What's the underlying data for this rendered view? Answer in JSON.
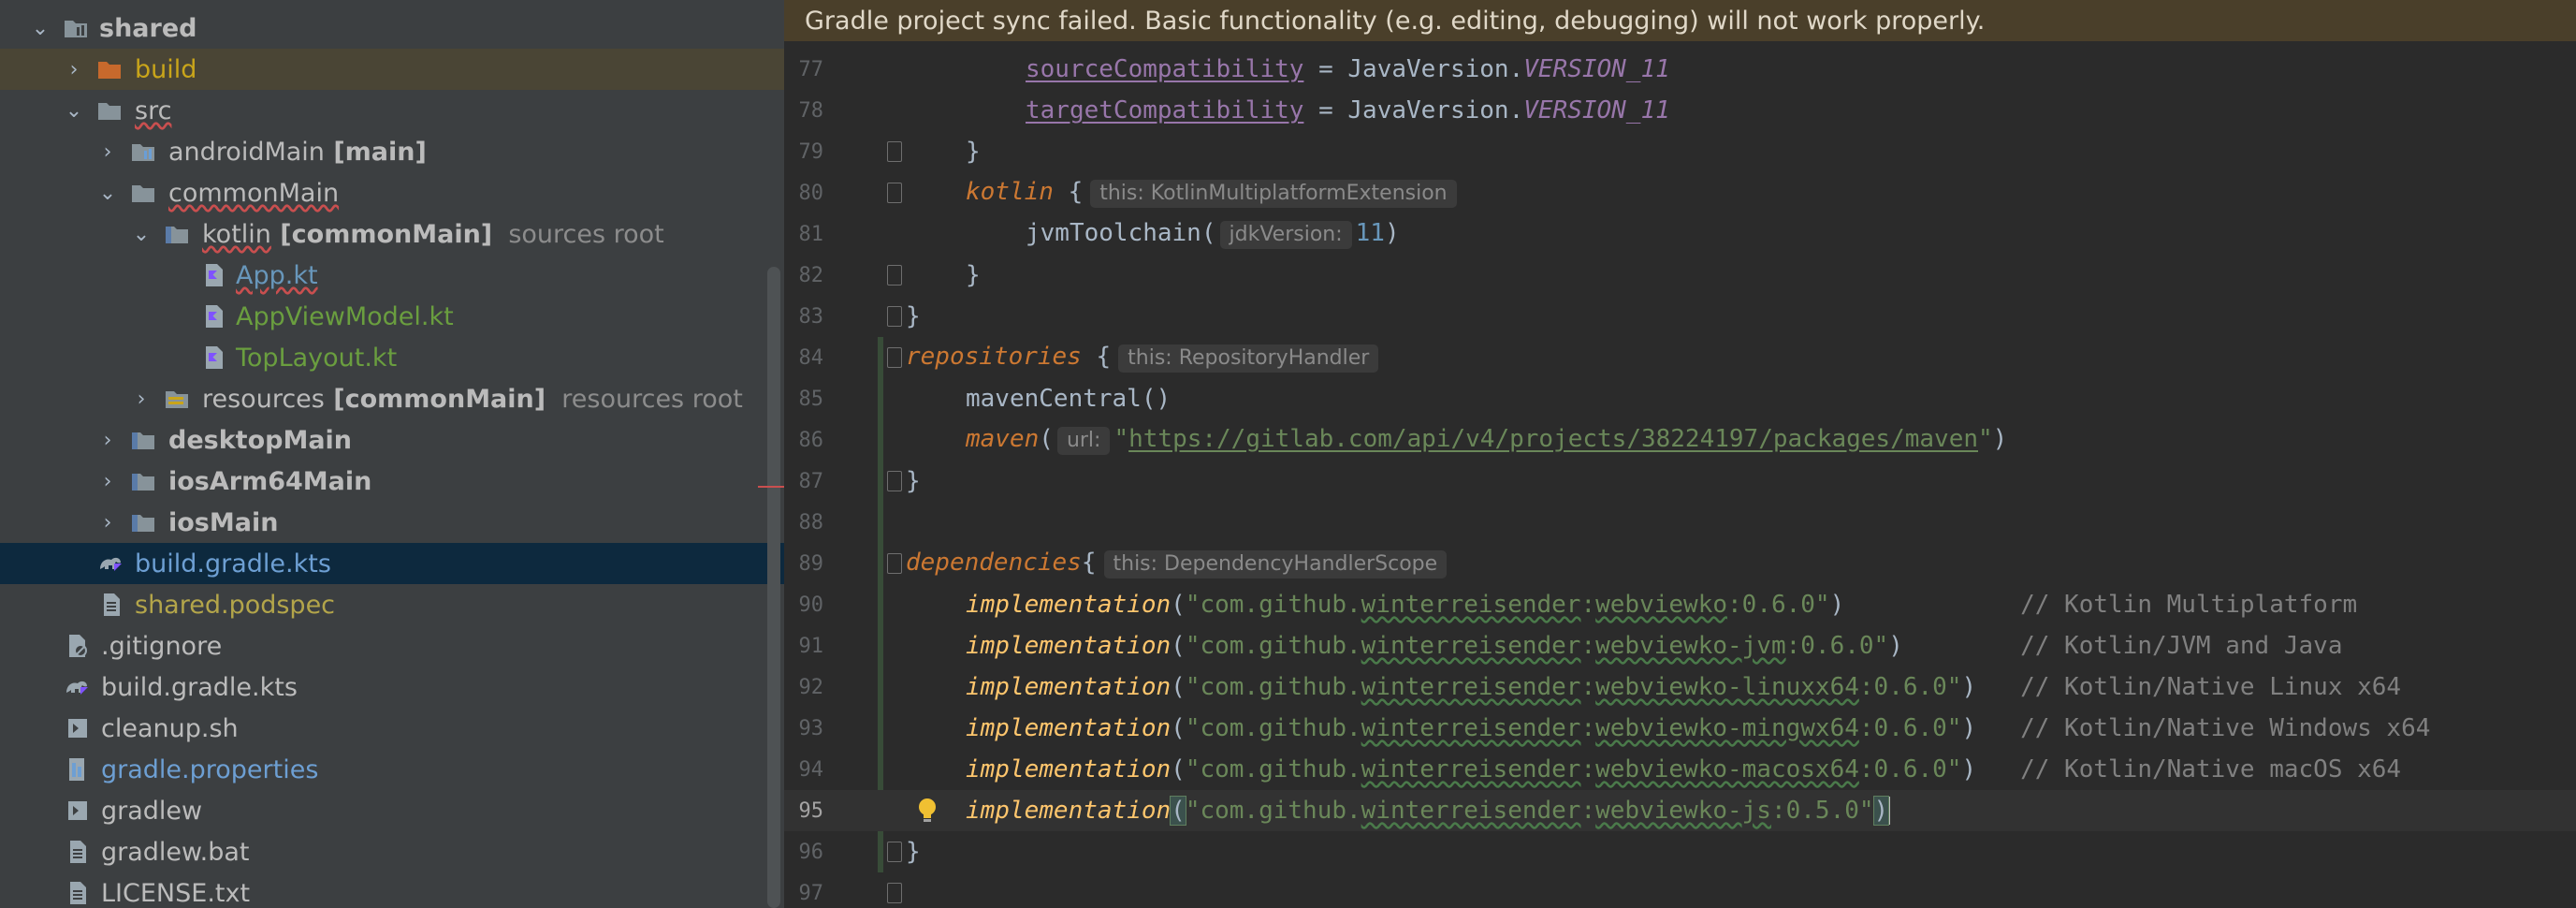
{
  "banner": "Gradle project sync failed. Basic functionality (e.g. editing, debugging) will not work properly.",
  "tree": {
    "top_partial": "…_ _ _ …",
    "items": [
      {
        "label": "shared",
        "suffix": "",
        "note": ""
      },
      {
        "label": "build",
        "suffix": "",
        "note": ""
      },
      {
        "label": "src",
        "suffix": "",
        "note": ""
      },
      {
        "label": "androidMain",
        "suffix": " [main]",
        "note": ""
      },
      {
        "label": "commonMain",
        "suffix": "",
        "note": ""
      },
      {
        "label": "kotlin",
        "suffix": " [commonMain]",
        "note": "sources root"
      },
      {
        "label": "App.kt",
        "suffix": "",
        "note": ""
      },
      {
        "label": "AppViewModel.kt",
        "suffix": "",
        "note": ""
      },
      {
        "label": "TopLayout.kt",
        "suffix": "",
        "note": ""
      },
      {
        "label": "resources",
        "suffix": " [commonMain]",
        "note": "resources root"
      },
      {
        "label": "desktopMain",
        "suffix": "",
        "note": ""
      },
      {
        "label": "iosArm64Main",
        "suffix": "",
        "note": ""
      },
      {
        "label": "iosMain",
        "suffix": "",
        "note": ""
      },
      {
        "label": "build.gradle.kts",
        "suffix": "",
        "note": ""
      },
      {
        "label": "shared.podspec",
        "suffix": "",
        "note": ""
      },
      {
        "label": ".gitignore",
        "suffix": "",
        "note": ""
      },
      {
        "label": "build.gradle.kts",
        "suffix": "",
        "note": ""
      },
      {
        "label": "cleanup.sh",
        "suffix": "",
        "note": ""
      },
      {
        "label": "gradle.properties",
        "suffix": "",
        "note": ""
      },
      {
        "label": "gradlew",
        "suffix": "",
        "note": ""
      },
      {
        "label": "gradlew.bat",
        "suffix": "",
        "note": ""
      },
      {
        "label": "LICENSE.txt",
        "suffix": "",
        "note": ""
      }
    ]
  },
  "editor": {
    "line_numbers": [
      "77",
      "78",
      "79",
      "80",
      "81",
      "82",
      "83",
      "84",
      "85",
      "86",
      "87",
      "88",
      "89",
      "90",
      "91",
      "92",
      "93",
      "94",
      "95",
      "96",
      "97"
    ],
    "code": {
      "l77_a": "sourceCompatibility",
      "l77_b": " = JavaVersion.",
      "l77_c": "VERSION_11",
      "l78_a": "targetCompatibility",
      "l78_b": " = JavaVersion.",
      "l78_c": "VERSION_11",
      "l79": "}",
      "l80_a": "kotlin",
      "l80_b": " {",
      "l80_hint": "this: KotlinMultiplatformExtension",
      "l81_a": "jvmToolchain(",
      "l81_hint": "jdkVersion:",
      "l81_num": "11",
      "l81_b": ")",
      "l82": "}",
      "l83": "}",
      "l84_a": "repositories",
      "l84_b": " {",
      "l84_hint": "this: RepositoryHandler",
      "l85": "mavenCentral()",
      "l86_a": "maven",
      "l86_b": "(",
      "l86_hint": "url:",
      "l86_q1": "\"",
      "l86_url": "https://gitlab.com/api/v4/projects/38224197/packages/maven",
      "l86_q2": "\"",
      "l86_c": ")",
      "l87": "}",
      "l89_a": "dependencies",
      "l89_b": "{",
      "l89_hint": "this: DependencyHandlerScope",
      "dep_fn": "implementation",
      "dep_prefix": "\"com.github.",
      "dep_group": "winterreisender",
      "dep_colon": ":",
      "l90_art": "webviewko",
      "l90_ver": ":0.6.0\"",
      "l90_pad": ")            ",
      "l90_cmt": "// Kotlin Multiplatform",
      "l91_art": "webviewko-jvm",
      "l91_ver": ":0.6.0\"",
      "l91_pad": ")        ",
      "l91_cmt": "// Kotlin/JVM and Java",
      "l92_art": "webviewko-linuxx64",
      "l92_ver": ":0.6.0\"",
      "l92_pad": ")   ",
      "l92_cmt": "// Kotlin/Native Linux x64",
      "l93_art": "webviewko-mingwx64",
      "l93_ver": ":0.6.0\"",
      "l93_pad": ")   ",
      "l93_cmt": "// Kotlin/Native Windows x64",
      "l94_art": "webviewko-macosx64",
      "l94_ver": ":0.6.0\"",
      "l94_pad": ")   ",
      "l94_cmt": "// Kotlin/Native macOS x64",
      "l95_art": "webviewko-js",
      "l95_ver": ":0.5.0\"",
      "l96": "}"
    }
  },
  "colors": {
    "tree_bg": "#3c3f41",
    "editor_bg": "#2b2b2b",
    "banner_bg": "#4a3f2a",
    "selection": "#0d293e",
    "keyword": "#cc7832",
    "function": "#ffc66d",
    "string": "#6a8759",
    "number": "#6897bb",
    "property": "#9876aa",
    "comment": "#808080"
  }
}
